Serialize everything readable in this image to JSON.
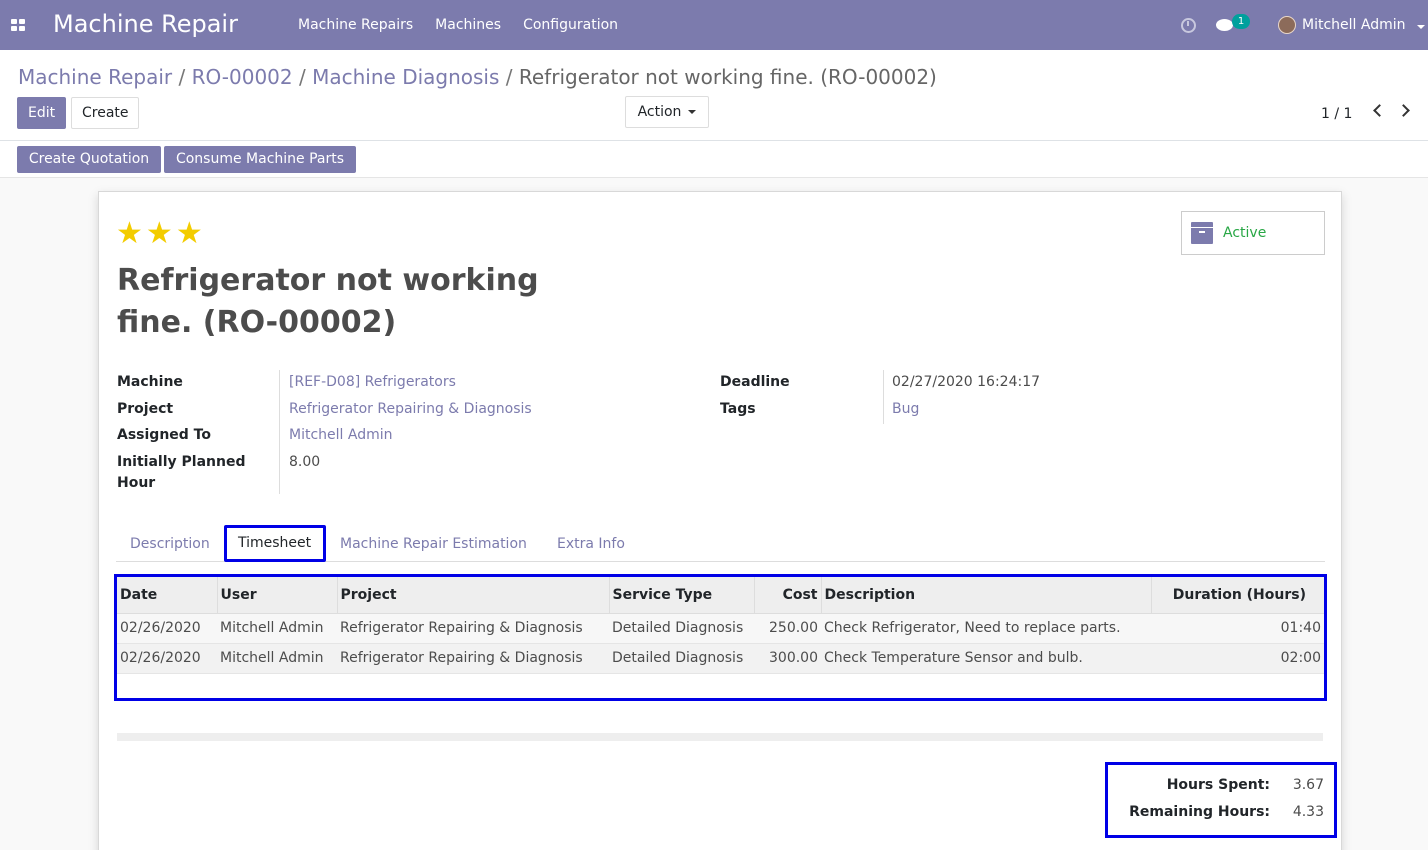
{
  "navbar": {
    "app_title": "Machine Repair",
    "menu": [
      "Machine Repairs",
      "Machines",
      "Configuration"
    ],
    "chat_count": "1",
    "user_name": "Mitchell Admin",
    "brand_color": "#7c7bad"
  },
  "breadcrumb": {
    "items": [
      "Machine Repair",
      "RO-00002",
      "Machine Diagnosis"
    ],
    "separator": "/",
    "current": "Refrigerator not working fine. (RO-00002)"
  },
  "control_panel": {
    "edit_label": "Edit",
    "create_label": "Create",
    "action_label": "Action",
    "pager": "1 / 1"
  },
  "header_buttons": {
    "create_quotation": "Create Quotation",
    "consume_parts": "Consume Machine Parts"
  },
  "record": {
    "stars": [
      "★",
      "★",
      "★"
    ],
    "priority_stars": 3,
    "status": "Active",
    "title": "Refrigerator not working fine. (RO-00002)",
    "fields_left": {
      "machine_label": "Machine",
      "machine_value": "[REF-D08] Refrigerators",
      "project_label": "Project",
      "project_value": "Refrigerator Repairing & Diagnosis",
      "assigned_label": "Assigned To",
      "assigned_value": "Mitchell Admin",
      "planned_label": "Initially Planned Hour",
      "planned_value": "8.00"
    },
    "fields_right": {
      "deadline_label": "Deadline",
      "deadline_value": "02/27/2020 16:24:17",
      "tags_label": "Tags",
      "tags_value": "Bug"
    }
  },
  "tabs": {
    "description": "Description",
    "timesheet": "Timesheet",
    "estimation": "Machine Repair Estimation",
    "extra": "Extra Info",
    "active": "Timesheet"
  },
  "timesheet": {
    "columns": [
      "Date",
      "User",
      "Project",
      "Service Type",
      "Cost",
      "Description",
      "Duration (Hours)"
    ],
    "rows": [
      [
        "02/26/2020",
        "Mitchell Admin",
        "Refrigerator Repairing & Diagnosis",
        "Detailed Diagnosis",
        "250.00",
        "Check Refrigerator, Need to replace parts.",
        "01:40"
      ],
      [
        "02/26/2020",
        "Mitchell Admin",
        "Refrigerator Repairing & Diagnosis",
        "Detailed Diagnosis",
        "300.00",
        "Check Temperature Sensor and bulb.",
        "02:00"
      ]
    ]
  },
  "totals": {
    "hours_spent_label": "Hours Spent:",
    "hours_spent_value": "3.67",
    "remaining_label": "Remaining Hours:",
    "remaining_value": "4.33"
  }
}
